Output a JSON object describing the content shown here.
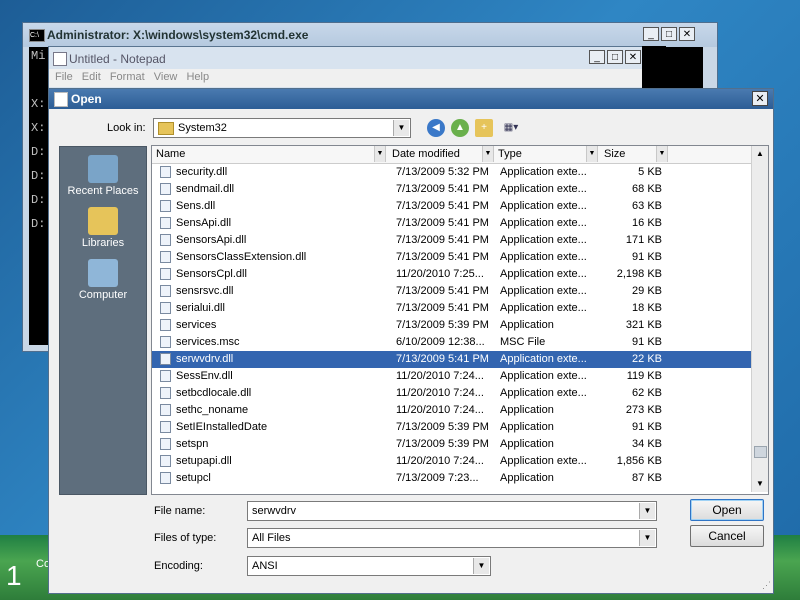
{
  "desktop": {
    "number": "1",
    "corner_text": "Co"
  },
  "cmd": {
    "title": "Administrator: X:\\windows\\system32\\cmd.exe",
    "icon_text": "C:\\",
    "lines": [
      "Mi",
      "",
      "X:",
      "X:",
      "D:",
      "D:",
      "D:",
      "D:"
    ]
  },
  "notepad": {
    "title": "Untitled - Notepad",
    "menu": [
      "File",
      "Edit",
      "Format",
      "View",
      "Help"
    ]
  },
  "dialog": {
    "title": "Open",
    "look_in_label": "Look in:",
    "look_in_value": "System32",
    "places": [
      {
        "label": "Recent Places",
        "icon": "recent-places-icon",
        "color": "#7aa4c8"
      },
      {
        "label": "Libraries",
        "icon": "libraries-icon",
        "color": "#e6c45a"
      },
      {
        "label": "Computer",
        "icon": "computer-icon",
        "color": "#8fb6d8"
      }
    ],
    "columns": [
      "Name",
      "Date modified",
      "Type",
      "Size"
    ],
    "files": [
      {
        "name": "security.dll",
        "date": "7/13/2009 5:32 PM",
        "type": "Application exte...",
        "size": "5 KB"
      },
      {
        "name": "sendmail.dll",
        "date": "7/13/2009 5:41 PM",
        "type": "Application exte...",
        "size": "68 KB"
      },
      {
        "name": "Sens.dll",
        "date": "7/13/2009 5:41 PM",
        "type": "Application exte...",
        "size": "63 KB"
      },
      {
        "name": "SensApi.dll",
        "date": "7/13/2009 5:41 PM",
        "type": "Application exte...",
        "size": "16 KB"
      },
      {
        "name": "SensorsApi.dll",
        "date": "7/13/2009 5:41 PM",
        "type": "Application exte...",
        "size": "171 KB"
      },
      {
        "name": "SensorsClassExtension.dll",
        "date": "7/13/2009 5:41 PM",
        "type": "Application exte...",
        "size": "91 KB"
      },
      {
        "name": "SensorsCpl.dll",
        "date": "11/20/2010 7:25...",
        "type": "Application exte...",
        "size": "2,198 KB"
      },
      {
        "name": "sensrsvc.dll",
        "date": "7/13/2009 5:41 PM",
        "type": "Application exte...",
        "size": "29 KB"
      },
      {
        "name": "serialui.dll",
        "date": "7/13/2009 5:41 PM",
        "type": "Application exte...",
        "size": "18 KB"
      },
      {
        "name": "services",
        "date": "7/13/2009 5:39 PM",
        "type": "Application",
        "size": "321 KB"
      },
      {
        "name": "services.msc",
        "date": "6/10/2009 12:38...",
        "type": "MSC File",
        "size": "91 KB"
      },
      {
        "name": "serwvdrv.dll",
        "date": "7/13/2009 5:41 PM",
        "type": "Application exte...",
        "size": "22 KB"
      },
      {
        "name": "SessEnv.dll",
        "date": "11/20/2010 7:24...",
        "type": "Application exte...",
        "size": "119 KB"
      },
      {
        "name": "setbcdlocale.dll",
        "date": "11/20/2010 7:24...",
        "type": "Application exte...",
        "size": "62 KB"
      },
      {
        "name": "sethc_noname",
        "date": "11/20/2010 7:24...",
        "type": "Application",
        "size": "273 KB"
      },
      {
        "name": "SetIEInstalledDate",
        "date": "7/13/2009 5:39 PM",
        "type": "Application",
        "size": "91 KB"
      },
      {
        "name": "setspn",
        "date": "7/13/2009 5:39 PM",
        "type": "Application",
        "size": "34 KB"
      },
      {
        "name": "setupapi.dll",
        "date": "11/20/2010 7:24...",
        "type": "Application exte...",
        "size": "1,856 KB"
      },
      {
        "name": "setupcl",
        "date": "7/13/2009 7:23...",
        "type": "Application",
        "size": "87 KB"
      }
    ],
    "selected_index": 11,
    "file_name_label": "File name:",
    "file_name_value": "serwvdrv",
    "files_of_type_label": "Files of type:",
    "files_of_type_value": "All Files",
    "encoding_label": "Encoding:",
    "encoding_value": "ANSI",
    "open_button": "Open",
    "cancel_button": "Cancel",
    "selection_color": "#3365b0"
  }
}
